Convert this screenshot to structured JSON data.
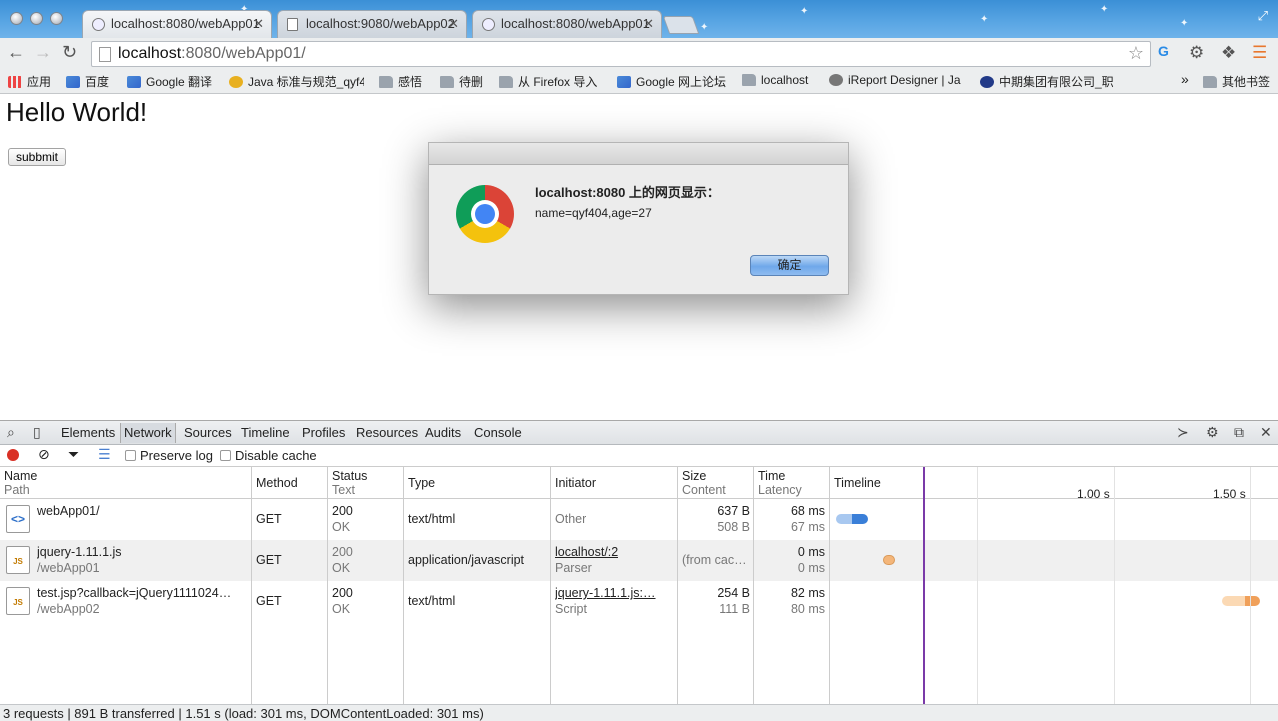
{
  "tabs": [
    {
      "title": "localhost:8080/webApp01",
      "active": true
    },
    {
      "title": "localhost:9080/webApp02",
      "active": false
    },
    {
      "title": "localhost:8080/webApp01",
      "active": false
    }
  ],
  "address": {
    "host": "localhost",
    "rest": ":8080/webApp01/"
  },
  "bookmarks": [
    "应用",
    "百度",
    "Google 翻译",
    "Java 标准与规范_qyf4",
    "感悟",
    "待删",
    "从 Firefox 导入",
    "Google 网上论坛",
    "localhost",
    "iReport Designer | Ja",
    "中期集团有限公司_职",
    "»",
    "其他书签"
  ],
  "page": {
    "heading": "Hello World!",
    "button": "subbmit"
  },
  "dialog": {
    "heading": "localhost:8080 上的网页显示：",
    "message": "name=qyf404,age=27",
    "ok": "确定"
  },
  "devtools": {
    "tabs": [
      "Elements",
      "Network",
      "Sources",
      "Timeline",
      "Profiles",
      "Resources",
      "Audits",
      "Console"
    ],
    "active_tab": "Network",
    "preserve_log": "Preserve log",
    "disable_cache": "Disable cache",
    "columns": {
      "name": "Name",
      "path": "Path",
      "method": "Method",
      "status": "Status",
      "text": "Text",
      "type": "Type",
      "initiator": "Initiator",
      "size": "Size",
      "content": "Content",
      "time": "Time",
      "latency": "Latency",
      "timeline": "Timeline"
    },
    "ticks": [
      "1.00 s",
      "1.50 s"
    ],
    "requests": [
      {
        "name": "webApp01/",
        "path": "",
        "method": "GET",
        "status": "200",
        "text": "OK",
        "type": "text/html",
        "initiator": "Other",
        "initiator_sub": "",
        "size": "637 B",
        "content": "508 B",
        "time": "68 ms",
        "latency": "67 ms"
      },
      {
        "name": "jquery-1.11.1.js",
        "path": "/webApp01",
        "method": "GET",
        "status": "200",
        "text": "OK",
        "type": "application/javascript",
        "initiator": "localhost/:2",
        "initiator_sub": "Parser",
        "size": "(from cac…",
        "content": "",
        "time": "0 ms",
        "latency": "0 ms"
      },
      {
        "name": "test.jsp?callback=jQuery1111024…",
        "path": "/webApp02",
        "method": "GET",
        "status": "200",
        "text": "OK",
        "type": "text/html",
        "initiator": "jquery-1.11.1.js:…",
        "initiator_sub": "Script",
        "size": "254 B",
        "content": "111 B",
        "time": "82 ms",
        "latency": "80 ms"
      }
    ],
    "status": "3 requests | 891 B transferred | 1.51 s (load: 301 ms, DOMContentLoaded: 301 ms)"
  }
}
